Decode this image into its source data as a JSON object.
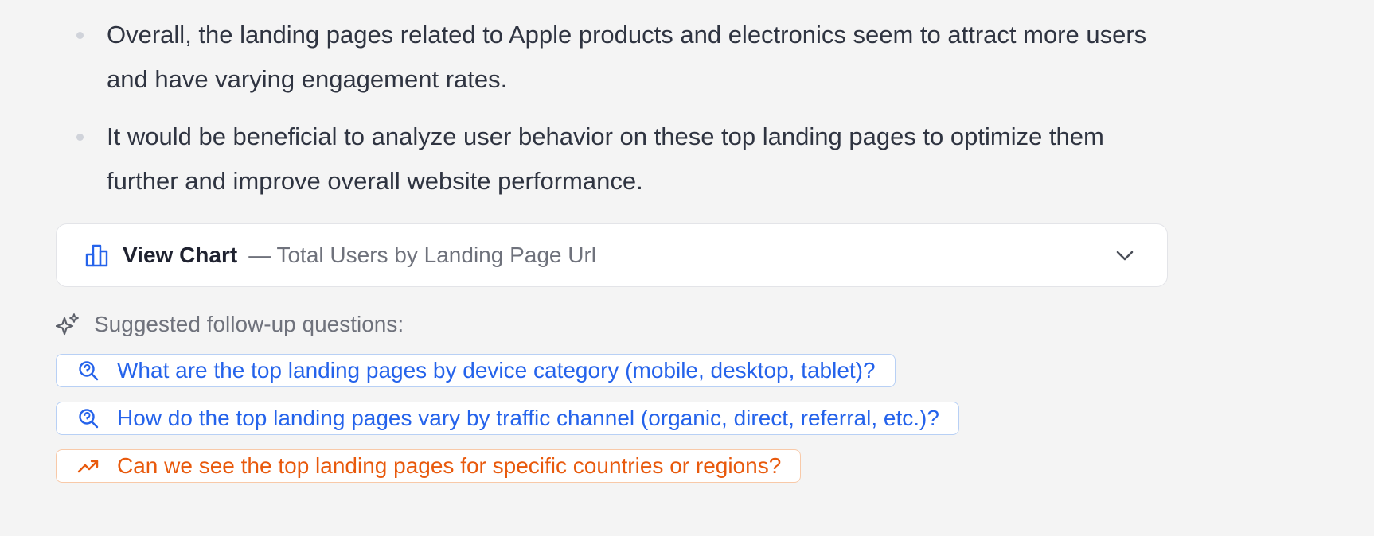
{
  "insights": {
    "bullets": [
      "Overall, the landing pages related to Apple products and electronics seem to attract more users and have varying engagement rates.",
      "It would be beneficial to analyze user behavior on these top landing pages to optimize them further and improve overall website performance."
    ]
  },
  "chart_panel": {
    "label": "View Chart",
    "subtitle": "— Total Users by Landing Page Url",
    "icon": "bar-chart-icon",
    "toggle_icon": "chevron-down-icon"
  },
  "suggestions": {
    "header": "Suggested follow-up questions:",
    "header_icon": "sparkle-icon",
    "items": [
      {
        "text": "What are the top landing pages by device category (mobile, desktop, tablet)?",
        "icon": "search-icon",
        "color": "#2563eb"
      },
      {
        "text": "How do the top landing pages vary by traffic channel (organic, direct, referral, etc.)?",
        "icon": "search-icon",
        "color": "#2563eb"
      },
      {
        "text": "Can we see the top landing pages for specific countries or regions?",
        "icon": "trending-up-icon",
        "color": "#e8590c"
      }
    ]
  }
}
